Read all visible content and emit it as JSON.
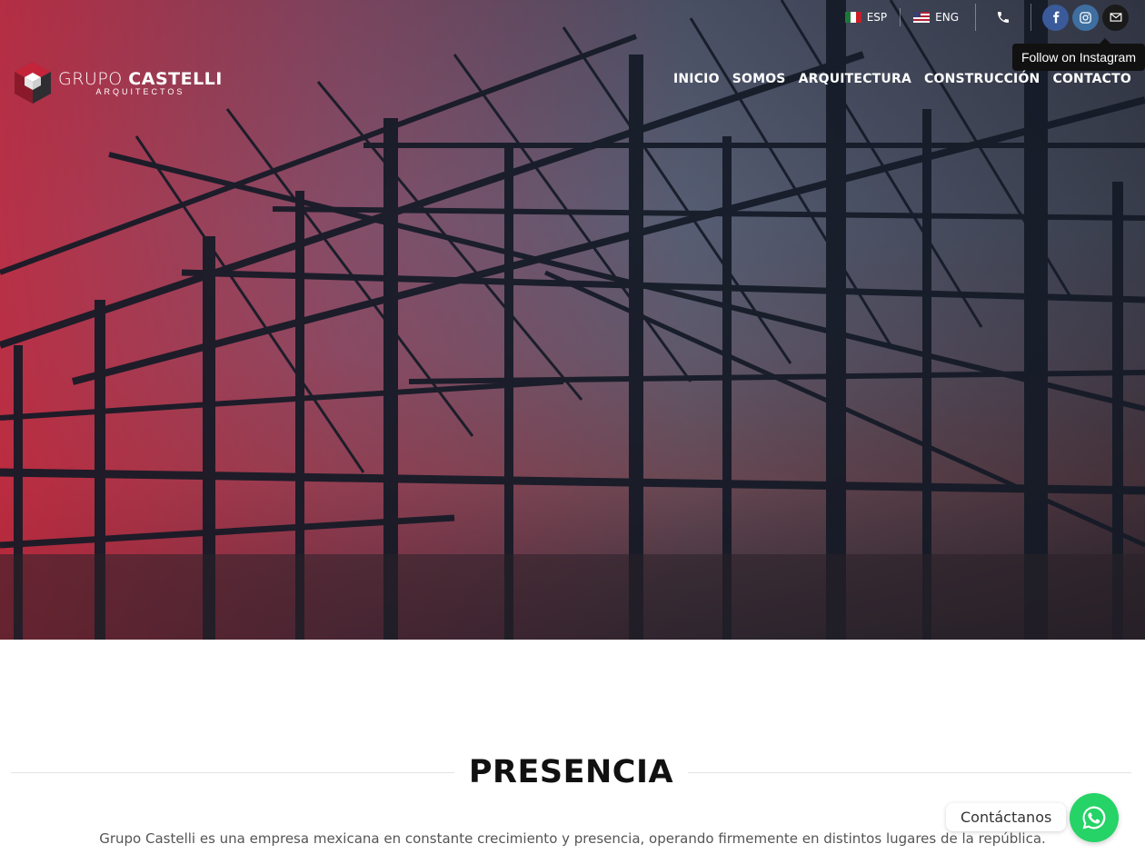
{
  "header": {
    "languages": [
      {
        "code": "mx",
        "label": "ESP"
      },
      {
        "code": "us",
        "label": "ENG"
      }
    ],
    "tooltip": "Follow on Instagram",
    "icons": {
      "phone": "phone-icon",
      "facebook": "facebook-icon",
      "instagram": "instagram-icon",
      "email": "email-icon"
    }
  },
  "logo": {
    "word1": "GRUPO",
    "word2": "CASTELLI",
    "sub": "ARQUITECTOS"
  },
  "nav": [
    "INICIO",
    "SOMOS",
    "ARQUITECTURA",
    "CONSTRUCCIÓN",
    "CONTACTO"
  ],
  "section": {
    "title": "PRESENCIA",
    "text": "Grupo Castelli es una empresa mexicana en constante crecimiento y presencia, operando firmemente en distintos lugares de la república."
  },
  "whatsapp": {
    "label": "Contáctanos"
  },
  "colors": {
    "brand_red": "#c4243a",
    "whatsapp": "#25d366",
    "facebook": "#3a5a9a"
  }
}
